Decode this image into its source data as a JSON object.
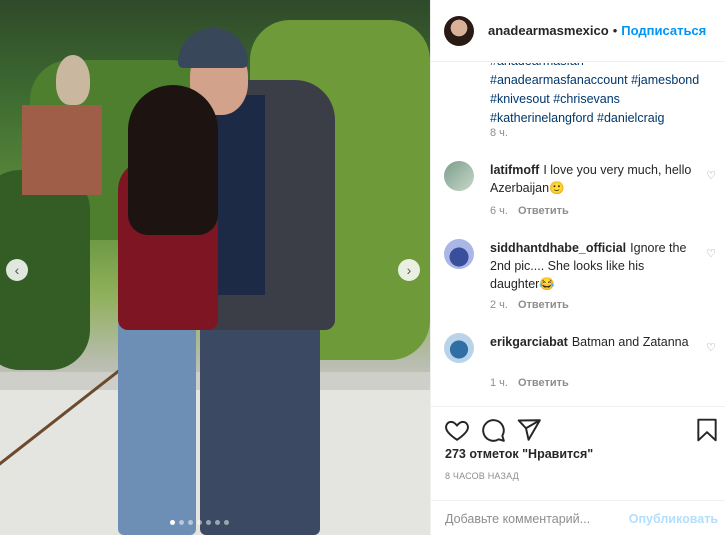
{
  "post": {
    "username": "anadearmasmexico",
    "follow_label": "Подписаться",
    "separator": "•"
  },
  "caption": {
    "truncated_line": "#anadearmasfan",
    "tags_line1": "#anadearmasfanaccount #jamesbond",
    "tags_line2": "#knivesout #chrisevans",
    "tags_line3": "#katherinelangford #danielcraig",
    "time": "8 ч."
  },
  "comments": [
    {
      "user": "latifmoff",
      "text": "I love you very much, hello Azerbaijan🙂",
      "time": "6 ч.",
      "reply_label": "Ответить"
    },
    {
      "user": "siddhantdhabe_official",
      "text": "Ignore the 2nd pic.... She looks like his daughter😂",
      "time": "2 ч.",
      "reply_label": "Ответить"
    },
    {
      "user": "erikgarciabat",
      "text": "Batman and Zatanna",
      "time": "1 ч.",
      "reply_label": "Ответить"
    }
  ],
  "actions": {
    "likes_text": "273 отметок \"Нравится\"",
    "posted_text": "8 ЧАСОВ НАЗАД"
  },
  "comment_box": {
    "placeholder": "Добавьте комментарий...",
    "publish_label": "Опубликовать"
  },
  "carousel": {
    "total": 7,
    "active": 0
  },
  "icons": {
    "like": "heart-icon",
    "comment": "comment-icon",
    "share": "paper-plane-icon",
    "save": "bookmark-icon",
    "prev": "chevron-left-icon",
    "next": "chevron-right-icon"
  },
  "colors": {
    "link": "#00376b",
    "accent": "#0095f6",
    "muted": "#8e8e8e",
    "text": "#262626"
  }
}
